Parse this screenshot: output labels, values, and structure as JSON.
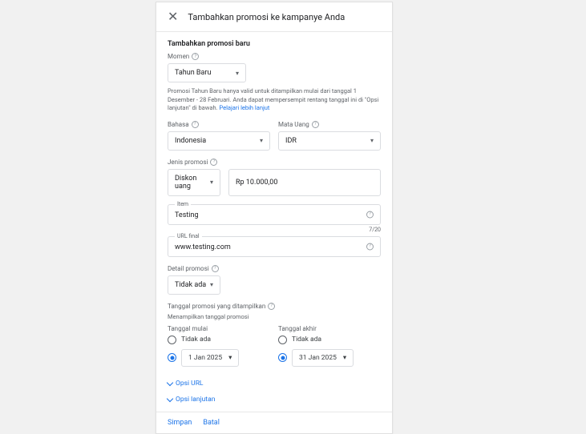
{
  "header": {
    "title": "Tambahkan promosi ke kampanye Anda"
  },
  "sections": {
    "new_promo_title": "Tambahkan promosi baru",
    "moment_label": "Momen",
    "moment_value": "Tahun Baru",
    "moment_help": "Promosi Tahun Baru hanya valid untuk ditampilkan mulai dari tanggal 1 Desember - 28 Februari. Anda dapat mempersempit rentang tanggal ini di \"Opsi lanjutan\" di bawah. ",
    "moment_link": "Pelajari lebih lanjut",
    "language_label": "Bahasa",
    "language_value": "Indonesia",
    "currency_label": "Mata Uang",
    "currency_value": "IDR",
    "promo_type_label": "Jenis promosi",
    "promo_type_value": "Diskon uang",
    "amount_value": "Rp 10.000,00",
    "item_label": "Item",
    "item_value": "Testing",
    "item_counter": "7/20",
    "url_label": "URL final",
    "url_value": "www.testing.com",
    "detail_label": "Detail promosi",
    "detail_value": "Tidak ada",
    "date_range_label": "Tanggal promosi yang ditampilkan",
    "date_range_sub": "Menampilkan tanggal promosi",
    "start_label": "Tanggal mulai",
    "end_label": "Tanggal akhir",
    "none_option": "Tidak ada",
    "start_date": "1 Jan 2025",
    "end_date": "31 Jan 2025",
    "url_options": "Opsi URL",
    "advanced_options": "Opsi lanjutan"
  },
  "footer": {
    "save": "Simpan",
    "cancel": "Batal"
  }
}
